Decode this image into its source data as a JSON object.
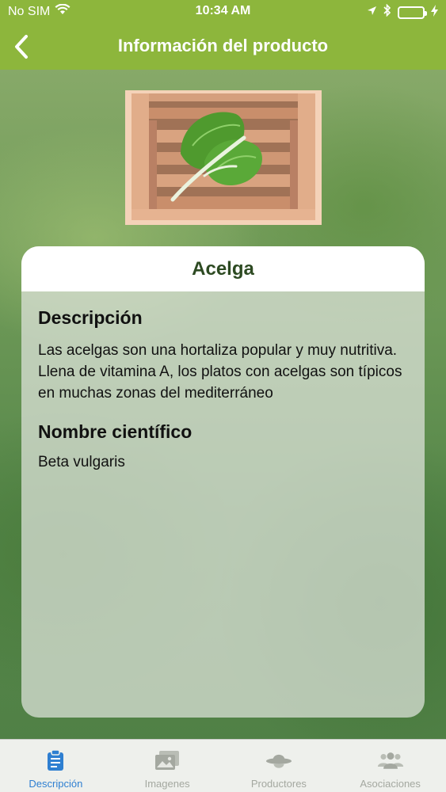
{
  "status_bar": {
    "carrier": "No SIM",
    "time": "10:34 AM"
  },
  "nav": {
    "title": "Información del producto",
    "back_icon": "chevron-left-icon"
  },
  "product": {
    "image_icon": "chard-in-crate-image",
    "name": "Acelga"
  },
  "description": {
    "heading": "Descripción",
    "text": "Las acelgas son una hortaliza popular y muy nutritiva. Llena de vitamina A, los platos con acelgas son típicos en muchas zonas del mediterráneo"
  },
  "scientific_name": {
    "heading": "Nombre científico",
    "text": "Beta vulgaris"
  },
  "tabs": [
    {
      "label": "Descripción",
      "icon": "clipboard-icon",
      "active": true
    },
    {
      "label": "Imagenes",
      "icon": "images-icon",
      "active": false
    },
    {
      "label": "Productores",
      "icon": "farmer-hat-icon",
      "active": false
    },
    {
      "label": "Asociaciones",
      "icon": "group-icon",
      "active": false
    }
  ],
  "colors": {
    "header_green": "#8db63c",
    "active_tab_blue": "#2e7fd1",
    "inactive_tab_gray": "#a4a8a0",
    "product_title_green": "#2d4a22"
  }
}
